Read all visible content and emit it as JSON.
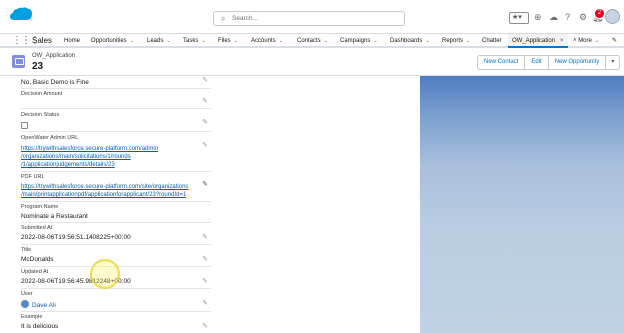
{
  "header": {
    "search_placeholder": "Search...",
    "notification_count": "2"
  },
  "nav": {
    "app_name": "Sales",
    "items": [
      {
        "label": "Home"
      },
      {
        "label": "Opportunities"
      },
      {
        "label": "Leads"
      },
      {
        "label": "Tasks"
      },
      {
        "label": "Files"
      },
      {
        "label": "Accounts"
      },
      {
        "label": "Contacts"
      },
      {
        "label": "Campaigns"
      },
      {
        "label": "Dashboards"
      },
      {
        "label": "Reports"
      },
      {
        "label": "Chatter"
      }
    ],
    "active_tab": "OW_Application",
    "more_label": "More"
  },
  "record": {
    "object_type": "OW_Application",
    "name": "23",
    "actions": [
      "New Contact",
      "Edit",
      "New Opportunity"
    ]
  },
  "fields": {
    "top_value": "No, Basic Demo is Fine",
    "decision_amount_label": "Decision Amount",
    "decision_status_label": "Decision Status",
    "admin_url_label": "OpenWater Admin URL",
    "admin_url_lines": [
      "https://trywithsalesforce.secure-platform.com/admin",
      "/organizations/main/solicitations/1/rounds",
      "/1/applicationjudgements/details/23"
    ],
    "pdf_url_label": "PDF URL",
    "pdf_url_lines": [
      "https://trywithsalesforce.secure-platform.com/site/organizations",
      "/main/printapplicationpdf/applicationforapplicant/23?roundId=1"
    ],
    "program_name_label": "Program Name",
    "program_name_value": "Nominate a Restaurant",
    "submitted_at_label": "Submitted At",
    "submitted_at_value": "2022-08-06T19:56:51.1408225+00:00",
    "title_label": "Title",
    "title_value": "McDonalds",
    "updated_at_label": "Updated At",
    "updated_at_value": "2022-08-06T19:56:45.9812248+00:00",
    "user_label": "User",
    "user_value": "Dave Ali",
    "example_label": "Example",
    "example_value": "It is delicious"
  }
}
